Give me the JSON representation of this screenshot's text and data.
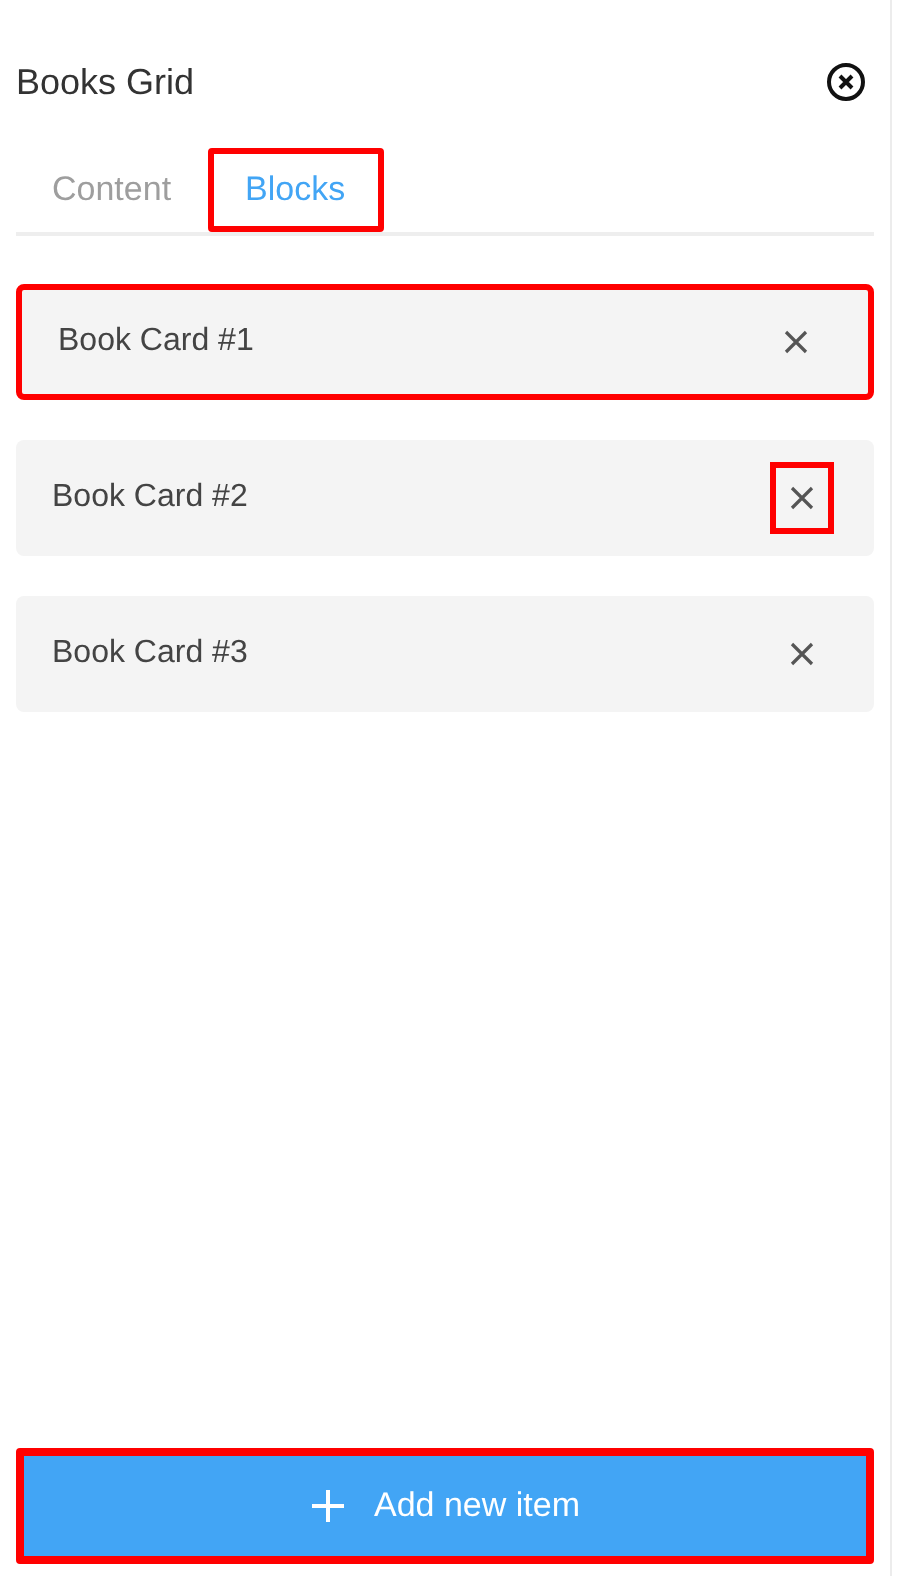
{
  "panel": {
    "title": "Books Grid"
  },
  "tabs": [
    {
      "label": "Content",
      "selected": false,
      "highlighted": false
    },
    {
      "label": "Blocks",
      "selected": true,
      "highlighted": true
    }
  ],
  "items": [
    {
      "label": "Book Card #1",
      "highlighted": true,
      "remove_highlighted": false
    },
    {
      "label": "Book Card #2",
      "highlighted": false,
      "remove_highlighted": true
    },
    {
      "label": "Book Card #3",
      "highlighted": false,
      "remove_highlighted": false
    }
  ],
  "add_button": {
    "label": "Add new item",
    "highlighted": true
  }
}
